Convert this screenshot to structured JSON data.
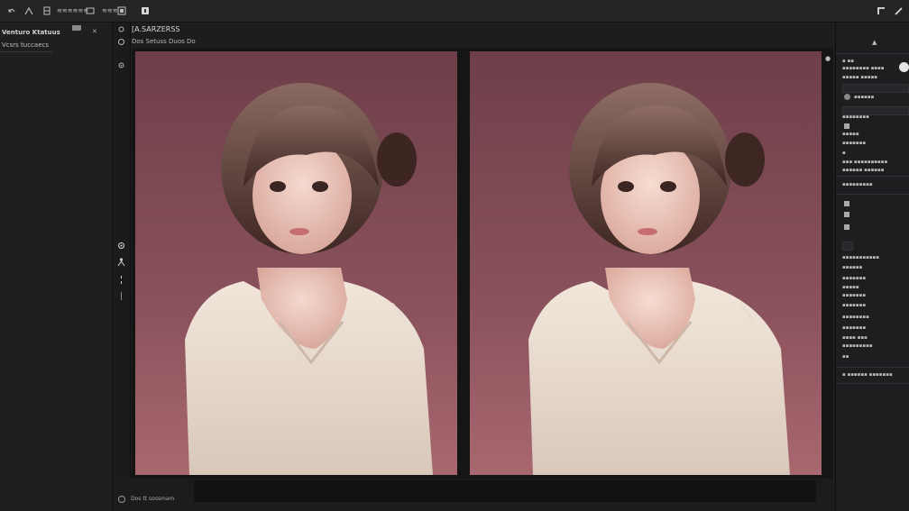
{
  "toolbar": {
    "items": [
      {
        "icon": "undo-icon",
        "label": ""
      },
      {
        "icon": "brush-icon",
        "label": ""
      },
      {
        "icon": "layers-icon",
        "label": ""
      },
      {
        "icon": "adjust-icon",
        "label": "≋≋≋≋≋≋"
      },
      {
        "icon": "frame-icon",
        "label": "≋≋≋"
      },
      {
        "icon": "mask-icon",
        "label": ""
      },
      {
        "icon": "export-icon",
        "label": ""
      }
    ],
    "right_items": [
      "crop-icon",
      "pen-icon"
    ]
  },
  "left_panel": {
    "title": "Venturo Ktatuus",
    "close_label": "✕",
    "subtitle": "Vcsrs tuccaecs"
  },
  "document": {
    "title": "[A.SARZERSS",
    "subtitle": "Dos Setuss Duos Do"
  },
  "canvas": {
    "panes": [
      "before",
      "after"
    ]
  },
  "bottom": {
    "label": "Dos tt sossmam"
  },
  "right_panel": {
    "rows": [
      "▪ ▪▪",
      "▪▪▪▪▪▪▪▪ ▪▪▪▪",
      "▪▪▪▪▪ ▪▪▪▪▪",
      "▪▪▪▪▪▪",
      "▪▪▪▪▪▪▪▪",
      "▪▪▪▪▪",
      "▪▪▪▪▪▪▪",
      "▪▪▪▪ ▪▪",
      "▪▪▪▪▪▪▪▪▪",
      "▪",
      "▪▪▪ ▪▪▪▪▪▪▪▪▪▪",
      "▪▪▪▪▪▪ ▪▪▪▪▪▪",
      "▪▪▪▪▪▪▪▪▪▪▪",
      "▪▪▪▪▪▪▪▪▪▪▪",
      "▪▪▪▪▪▪",
      "▪▪▪▪▪▪▪",
      "▪▪▪▪▪",
      "▪▪▪▪▪▪▪",
      "▪▪▪▪▪▪▪",
      "▪▪▪▪▪▪▪▪",
      "▪▪▪▪▪▪▪",
      "▪▪▪▪ ▪▪▪",
      "▪▪▪▪▪▪▪▪▪",
      "▪▪",
      "▪ ▪▪▪▪▪▪ ▪▪▪▪▪▪▪"
    ]
  },
  "colors": {
    "app_bg": "#1c1d1f",
    "panel": "#1e1f21",
    "canvas_bg": "#7d4c55",
    "accent": "#e6e6e6"
  }
}
